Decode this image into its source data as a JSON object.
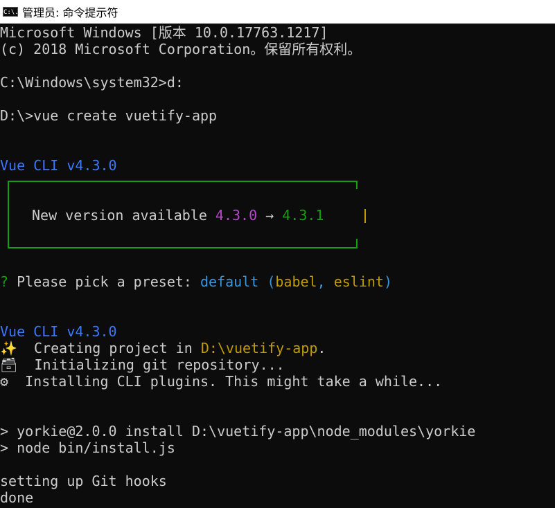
{
  "window": {
    "title": "管理员: 命令提示符",
    "icon": "cmd-icon",
    "icon_text": "C:\\."
  },
  "console": {
    "lines": [
      "Microsoft Windows [版本 10.0.17763.1217]",
      "(c) 2018 Microsoft Corporation。保留所有权利。",
      "C:\\Windows\\system32>d:",
      "D:\\>vue create vuetify-app",
      "Vue CLI v4.3.0",
      "New version available ",
      "4.3.0",
      " → ",
      "4.3.1",
      "?",
      " Please pick a preset: ",
      "default",
      " (",
      "babel",
      ", ",
      "eslint",
      ")",
      "Vue CLI v4.3.0",
      "✨  Creating project in ",
      "D:\\vuetify-app",
      ".",
      "🗃  Initializing git repository...",
      "⚙  Installing CLI plugins. This might take a while...",
      "> yorkie@2.0.0 install D:\\vuetify-app\\node_modules\\yorkie",
      "> node bin/install.js",
      "setting up Git hooks",
      "done"
    ]
  },
  "colors": {
    "background": "#0c0c0c",
    "text": "#cccccc",
    "blue": "#3b78ff",
    "purple": "#b148c6",
    "green": "#13a10e",
    "yellow": "#c19c00",
    "cyan": "#3a96dd"
  }
}
